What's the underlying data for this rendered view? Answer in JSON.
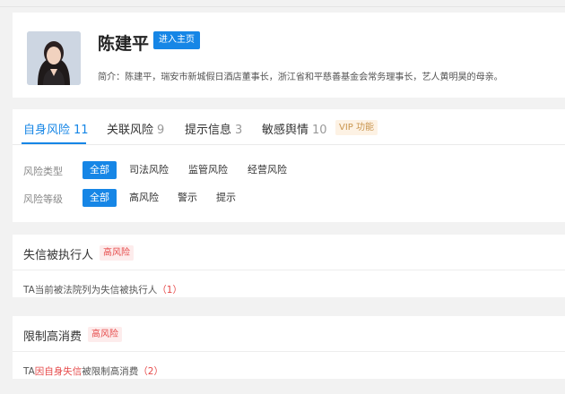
{
  "profile": {
    "name": "陈建平",
    "enter_button": "进入主页",
    "intro": "简介：陈建平，瑞安市新城假日酒店董事长，浙江省和平慈善基金会常务理事长，艺人黄明昊的母亲。"
  },
  "tabs": [
    {
      "label": "自身风险",
      "count": "11"
    },
    {
      "label": "关联风险",
      "count": "9"
    },
    {
      "label": "提示信息",
      "count": "3"
    },
    {
      "label": "敏感舆情",
      "count": "10"
    }
  ],
  "vip_label": "VIP 功能",
  "filters": {
    "type_label": "风险类型",
    "type_options": [
      "全部",
      "司法风险",
      "监管风险",
      "经营风险"
    ],
    "level_label": "风险等级",
    "level_options": [
      "全部",
      "高风险",
      "警示",
      "提示"
    ]
  },
  "risks": [
    {
      "title": "失信被执行人",
      "badge": "高风险",
      "text_prefix": "TA当前被法院列为失信被执行人",
      "text_highlight": "",
      "text_suffix": "",
      "count": "（1）"
    },
    {
      "title": "限制高消费",
      "badge": "高风险",
      "text_prefix": "TA",
      "text_highlight": "因自身失信",
      "text_suffix": "被限制高消费",
      "count": "（2）"
    }
  ],
  "colors": {
    "accent": "#1686e6",
    "danger": "#e64a4a",
    "vip": "#c99650"
  }
}
